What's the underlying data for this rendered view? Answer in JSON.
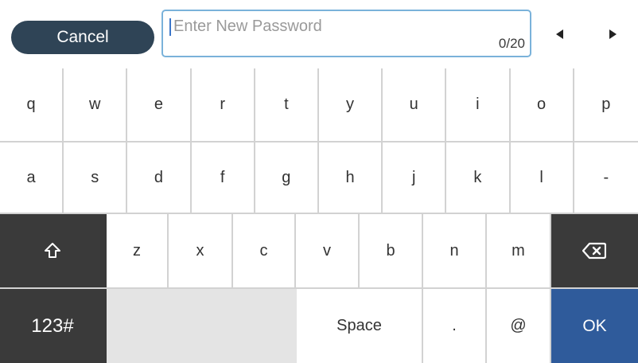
{
  "topbar": {
    "cancel_label": "Cancel",
    "input_placeholder": "Enter New Password",
    "input_value": "",
    "char_count": "0/20",
    "left_arrow_icon": "cursor-left-icon",
    "right_arrow_icon": "cursor-right-icon"
  },
  "keyboard": {
    "row1": [
      "q",
      "w",
      "e",
      "r",
      "t",
      "y",
      "u",
      "i",
      "o",
      "p"
    ],
    "row2": [
      "a",
      "s",
      "d",
      "f",
      "g",
      "h",
      "j",
      "k",
      "l",
      "-"
    ],
    "row3": {
      "shift_icon": "shift-icon",
      "letters": [
        "z",
        "x",
        "c",
        "v",
        "b",
        "n",
        "m"
      ],
      "backspace_icon": "backspace-icon"
    },
    "row4": {
      "mode_label": "123#",
      "space_label": "Space",
      "period_label": ".",
      "at_label": "@",
      "ok_label": "OK"
    }
  },
  "colors": {
    "cancel_bg": "#2f4456",
    "input_border": "#7ab2da",
    "dark_key": "#3a3a3a",
    "ok_key": "#2f5b9b",
    "key_bg": "#ffffff",
    "divider": "#d2d2d2"
  }
}
